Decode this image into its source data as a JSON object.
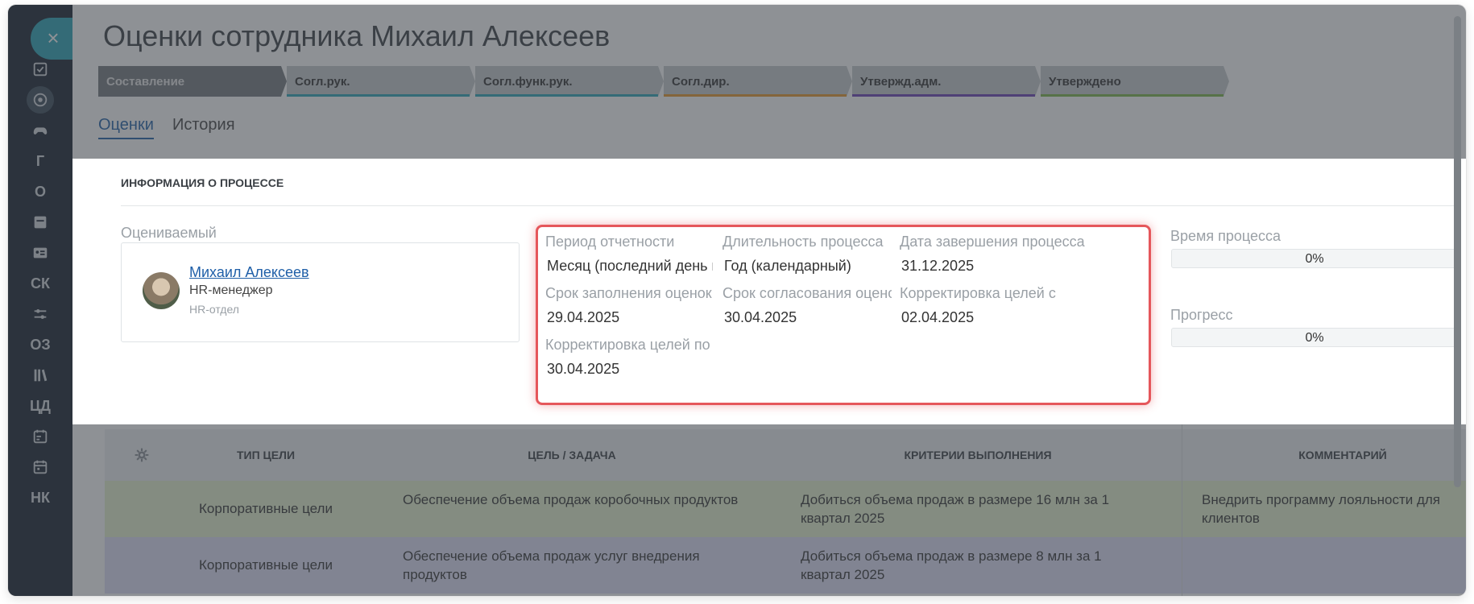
{
  "sidebar": {
    "close_label": "×",
    "items": [
      {
        "icon": "checkbox-icon",
        "label": ""
      },
      {
        "icon": "badge-icon",
        "label": ""
      },
      {
        "icon": "gamepad-icon",
        "label": ""
      },
      {
        "icon": "",
        "label": "Г"
      },
      {
        "icon": "",
        "label": "О"
      },
      {
        "icon": "window-icon",
        "label": ""
      },
      {
        "icon": "id-card-icon",
        "label": ""
      },
      {
        "icon": "",
        "label": "СК"
      },
      {
        "icon": "sliders-icon",
        "label": ""
      },
      {
        "icon": "",
        "label": "ОЗ"
      },
      {
        "icon": "library-icon",
        "label": ""
      },
      {
        "icon": "",
        "label": "ЦД"
      },
      {
        "icon": "calendar-edit-icon",
        "label": ""
      },
      {
        "icon": "calendar-icon",
        "label": ""
      },
      {
        "icon": "",
        "label": "НК"
      }
    ]
  },
  "header": {
    "title": "Оценки сотрудника Михаил Алексеев"
  },
  "steps": [
    {
      "label": "Составление",
      "color": "#75797e"
    },
    {
      "label": "Согл.рук.",
      "color": "#2aa5b8"
    },
    {
      "label": "Согл.функ.рук.",
      "color": "#2aa5b8"
    },
    {
      "label": "Согл.дир.",
      "color": "#e8962a"
    },
    {
      "label": "Утвержд.адм.",
      "color": "#6a3fb5"
    },
    {
      "label": "Утверждено",
      "color": "#7ab648"
    }
  ],
  "tabs": [
    {
      "label": "Оценки",
      "active": true
    },
    {
      "label": "История",
      "active": false
    }
  ],
  "info": {
    "heading": "ИНФОРМАЦИЯ О ПРОЦЕССЕ",
    "assessed_label": "Оцениваемый",
    "person": {
      "name": "Михаил Алексеев",
      "role": "HR-менеджер",
      "department": "HR-отдел"
    },
    "fields": {
      "period_label": "Период отчетности",
      "period_value": "Месяц (последний день ме",
      "duration_label": "Длительность процесса",
      "duration_value": "Год (календарный)",
      "end_date_label": "Дата завершения процесса",
      "end_date_value": "31.12.2025",
      "fill_deadline_label": "Срок заполнения оценок",
      "fill_deadline_value": "29.04.2025",
      "approve_deadline_label": "Срок согласования оценок",
      "approve_deadline_value": "30.04.2025",
      "goals_from_label": "Корректировка целей с",
      "goals_from_value": "02.04.2025",
      "goals_to_label": "Корректировка целей по",
      "goals_to_value": "30.04.2025"
    },
    "process_time": {
      "label": "Время процесса",
      "value": 0,
      "text": "0%"
    },
    "progress": {
      "label": "Прогресс",
      "value": 0,
      "text": "0%"
    }
  },
  "table": {
    "headers": {
      "type": "ТИП ЦЕЛИ",
      "goal": "ЦЕЛЬ / ЗАДАЧА",
      "criteria": "КРИТЕРИИ ВЫПОЛНЕНИЯ",
      "comment": "КОММЕНТАРИЙ"
    },
    "rows": [
      {
        "type": "Корпоративные цели",
        "goal": "Обеспечение объема продаж коробочных продуктов",
        "criteria": "Добиться объема продаж в размере 16 млн за 1 квартал 2025",
        "comment": "Внедрить программу лояльности для клиентов"
      },
      {
        "type": "Корпоративные цели",
        "goal": "Обеспечение объема продаж услуг внедрения продуктов",
        "criteria": "Добиться объема продаж в размере 8 млн за 1 квартал 2025",
        "comment": ""
      }
    ]
  },
  "colors": {
    "accent": "#2aa5b8",
    "link": "#1f5fa8",
    "highlight": "#e5575b",
    "sidebar": "#16202e",
    "row_green": "#e7f2cf",
    "row_purple": "#e0e1f7"
  }
}
